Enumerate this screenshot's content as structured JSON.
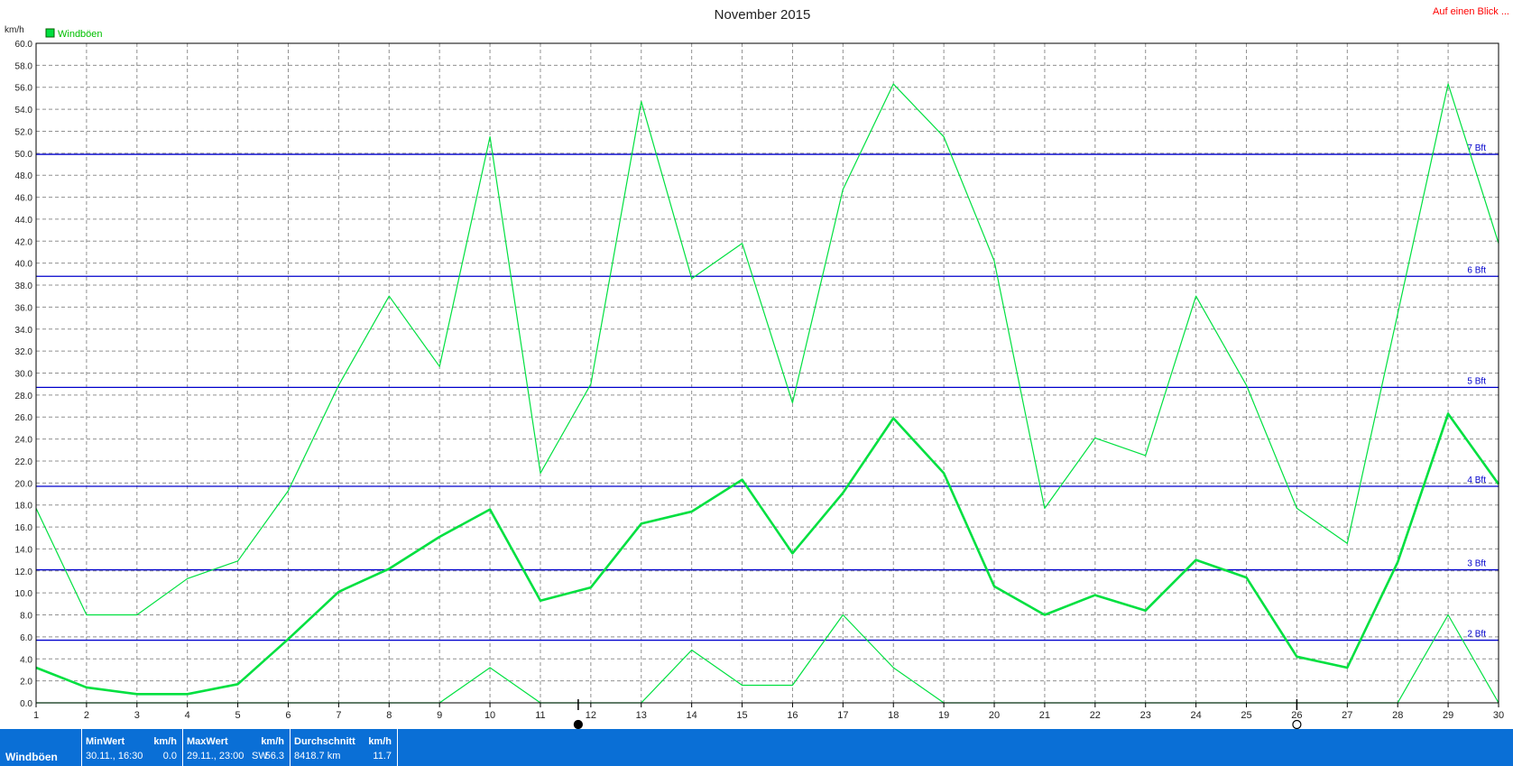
{
  "chart_data": {
    "type": "line",
    "title": "November 2015",
    "ylabel": "km/h",
    "ylim": [
      0,
      60
    ],
    "ytick_step": 2,
    "x": [
      1,
      2,
      3,
      4,
      5,
      6,
      7,
      8,
      9,
      10,
      11,
      12,
      13,
      14,
      15,
      16,
      17,
      18,
      19,
      20,
      21,
      22,
      23,
      24,
      25,
      26,
      27,
      28,
      29,
      30
    ],
    "grid": true,
    "legend": "top-left",
    "legend_label": "Windböen",
    "series": [
      {
        "name": "Windböen",
        "role": "max",
        "values": [
          17.7,
          8.0,
          8.0,
          11.3,
          12.9,
          19.3,
          28.9,
          37.0,
          30.6,
          51.5,
          20.9,
          29.0,
          54.7,
          38.6,
          41.8,
          27.3,
          46.7,
          56.3,
          51.5,
          40.2,
          17.7,
          24.1,
          22.5,
          37.0,
          28.9,
          17.7,
          14.5,
          35.4,
          56.3,
          41.8
        ]
      },
      {
        "name": "Windböen",
        "role": "avg",
        "values": [
          3.2,
          1.4,
          0.8,
          0.8,
          1.7,
          5.8,
          10.1,
          12.2,
          15.1,
          17.6,
          9.3,
          10.5,
          16.3,
          17.4,
          20.3,
          13.6,
          19.1,
          25.9,
          20.9,
          10.6,
          8.0,
          9.8,
          8.4,
          13.0,
          11.4,
          4.2,
          3.2,
          12.8,
          26.3,
          19.9
        ]
      },
      {
        "name": "Windböen",
        "role": "min",
        "values": [
          0,
          0,
          0,
          0,
          0,
          0,
          0,
          0,
          0,
          3.2,
          0,
          0,
          0,
          4.8,
          1.6,
          1.6,
          8.0,
          3.2,
          0,
          0,
          0,
          0,
          0,
          0,
          0,
          0,
          0,
          0,
          8.0,
          0
        ]
      }
    ],
    "reference_lines": [
      {
        "label": "2 Bft",
        "value": 5.7
      },
      {
        "label": "3 Bft",
        "value": 12.1
      },
      {
        "label": "4 Bft",
        "value": 19.7
      },
      {
        "label": "5 Bft",
        "value": 28.7
      },
      {
        "label": "6 Bft",
        "value": 38.8
      },
      {
        "label": "7 Bft",
        "value": 49.9
      }
    ],
    "moon_markers": [
      {
        "x": 11.75,
        "phase": "new-moon"
      },
      {
        "x": 26,
        "phase": "full-moon"
      }
    ]
  },
  "header": {
    "link_text": "Auf einen Blick ..."
  },
  "stats": {
    "series_label": "Windböen",
    "min": {
      "header": "MinWert",
      "unit": "km/h",
      "when": "30.11., 16:30",
      "value": "0.0"
    },
    "max": {
      "header": "MaxWert",
      "unit": "km/h",
      "when": "29.11., 23:00",
      "dir": "SW",
      "value": "56.3"
    },
    "avg": {
      "header": "Durchschnitt",
      "unit": "km/h",
      "distance": "8418.7 km",
      "value": "11.7"
    }
  },
  "colors": {
    "line": "#00e040",
    "reference": "#0000cc",
    "grid": "#909090",
    "stats_bg": "#0a6fd6",
    "link": "#ff0000"
  }
}
